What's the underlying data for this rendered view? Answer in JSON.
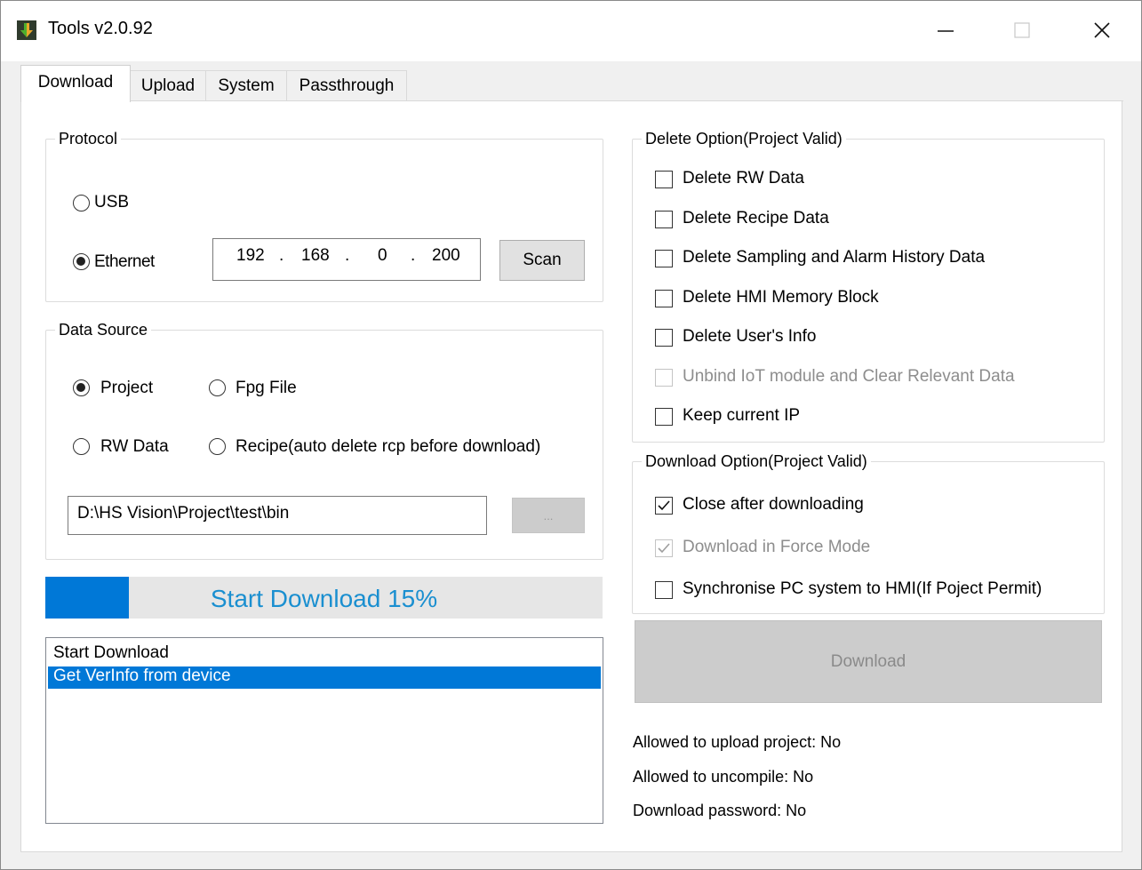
{
  "window": {
    "title": "Tools v2.0.92",
    "minimize_glyph": "—",
    "maximize_glyph": "☐",
    "close_glyph": "✕",
    "icon": "app-download-icon"
  },
  "tabs": [
    {
      "label": "Download",
      "active": true
    },
    {
      "label": "Upload",
      "active": false
    },
    {
      "label": "System",
      "active": false
    },
    {
      "label": "Passthrough",
      "active": false
    }
  ],
  "protocol": {
    "legend": "Protocol",
    "usb_label": "USB",
    "ethernet_label": "Ethernet",
    "selected": "Ethernet",
    "ip": [
      "192",
      "168",
      "0",
      "200"
    ],
    "ip_separator": ".",
    "scan_label": "Scan"
  },
  "data_source": {
    "legend": "Data Source",
    "project_label": "Project",
    "fpg_label": "Fpg File",
    "rw_label": "RW Data",
    "recipe_label": "Recipe(auto delete rcp before download)",
    "selected": "Project",
    "path_value": "D:\\HS Vision\\Project\\test\\bin",
    "browse_label": "..."
  },
  "progress": {
    "label": "Start Download 15%",
    "percent": 15,
    "color": "#0078d7",
    "text_color": "#1a8fd0"
  },
  "log": {
    "items": [
      {
        "text": "Start Download",
        "selected": false
      },
      {
        "text": "Get VerInfo from device",
        "selected": true
      }
    ],
    "selection_color": "#0078d7"
  },
  "delete_option": {
    "legend": "Delete Option(Project Valid)",
    "items": [
      {
        "label": "Delete RW Data",
        "checked": false,
        "enabled": true
      },
      {
        "label": "Delete Recipe Data",
        "checked": false,
        "enabled": true
      },
      {
        "label": "Delete Sampling and Alarm History Data",
        "checked": false,
        "enabled": true
      },
      {
        "label": "Delete HMI Memory Block",
        "checked": false,
        "enabled": true
      },
      {
        "label": "Delete User's Info",
        "checked": false,
        "enabled": true
      },
      {
        "label": "Unbind IoT module and Clear Relevant Data",
        "checked": false,
        "enabled": false
      },
      {
        "label": "Keep current IP",
        "checked": false,
        "enabled": true
      }
    ]
  },
  "download_option": {
    "legend": "Download Option(Project Valid)",
    "items": [
      {
        "label": "Close after downloading",
        "checked": true,
        "enabled": true
      },
      {
        "label": "Download in Force Mode",
        "checked": true,
        "enabled": false
      },
      {
        "label": "Synchronise PC system to HMI(If Poject Permit)",
        "checked": false,
        "enabled": true
      }
    ]
  },
  "download_button": {
    "label": "Download",
    "enabled": false
  },
  "status": {
    "upload_project": "Allowed to upload project: No",
    "uncompile": "Allowed to uncompile: No",
    "password": "Download password: No"
  }
}
